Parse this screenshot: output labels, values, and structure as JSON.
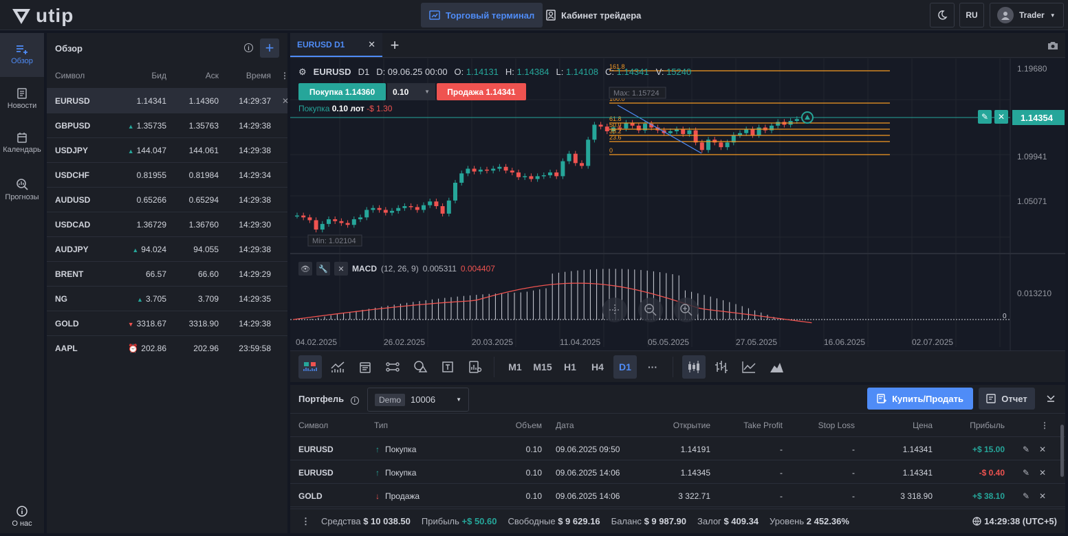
{
  "app": {
    "logo_text": "utip",
    "nav_terminal": "Торговый терминал",
    "nav_cabinet": "Кабинет трейдера",
    "lang": "RU",
    "user": "Trader"
  },
  "sidebar": {
    "items": [
      {
        "label": "Обзор",
        "icon": "overview-icon"
      },
      {
        "label": "Новости",
        "icon": "news-icon"
      },
      {
        "label": "Календарь",
        "icon": "calendar-icon"
      },
      {
        "label": "Прогнозы",
        "icon": "forecast-icon"
      }
    ],
    "about": "О нас"
  },
  "watchlist": {
    "title": "Обзор",
    "columns": {
      "symbol": "Символ",
      "bid": "Бид",
      "ask": "Аск",
      "time": "Время"
    },
    "rows": [
      {
        "symbol": "EURUSD",
        "dir": "",
        "bid": "1.14341",
        "ask": "1.14360",
        "time": "14:29:37"
      },
      {
        "symbol": "GBPUSD",
        "dir": "up",
        "bid": "1.35735",
        "ask": "1.35763",
        "time": "14:29:38"
      },
      {
        "symbol": "USDJPY",
        "dir": "up",
        "bid": "144.047",
        "ask": "144.061",
        "time": "14:29:38"
      },
      {
        "symbol": "USDCHF",
        "dir": "",
        "bid": "0.81955",
        "ask": "0.81984",
        "time": "14:29:34"
      },
      {
        "symbol": "AUDUSD",
        "dir": "",
        "bid": "0.65266",
        "ask": "0.65294",
        "time": "14:29:38"
      },
      {
        "symbol": "USDCAD",
        "dir": "",
        "bid": "1.36729",
        "ask": "1.36760",
        "time": "14:29:30"
      },
      {
        "symbol": "AUDJPY",
        "dir": "up",
        "bid": "94.024",
        "ask": "94.055",
        "time": "14:29:38"
      },
      {
        "symbol": "BRENT",
        "dir": "",
        "bid": "66.57",
        "ask": "66.60",
        "time": "14:29:29"
      },
      {
        "symbol": "NG",
        "dir": "up",
        "bid": "3.705",
        "ask": "3.709",
        "time": "14:29:35"
      },
      {
        "symbol": "GOLD",
        "dir": "down",
        "bid": "3318.67",
        "ask": "3318.90",
        "time": "14:29:38"
      },
      {
        "symbol": "AAPL",
        "dir": "clock",
        "bid": "202.86",
        "ask": "202.96",
        "time": "23:59:58"
      }
    ]
  },
  "chart": {
    "tab_label": "EURUSD D1",
    "symbol": "EURUSD",
    "timeframe": "D1",
    "date": "D: 09.06.25 00:00",
    "open_label": "O:",
    "open": "1.14131",
    "high_label": "H:",
    "high": "1.14384",
    "low_label": "L:",
    "low": "1.14108",
    "close_label": "C:",
    "close": "1.14341",
    "vol_label": "V:",
    "vol": "15240",
    "buy_button": "Покупка 1.14360",
    "sell_button": "Продажа 1.14341",
    "lot": "0.10",
    "position_prefix": "Покупка",
    "position_lot": "0.10 лот",
    "position_pl": "-$ 1.30",
    "current_price": "1.14354",
    "max_label": "Max: 1.15724",
    "min_label": "Min: 1.02104",
    "price_axis": [
      "1.19680",
      "1.09941",
      "1.05071"
    ],
    "fib_levels": [
      "161.8",
      "100.0",
      "61.8",
      "50.0",
      "38.2",
      "23.6",
      "0"
    ],
    "macd_label": "MACD",
    "macd_params": "(12, 26, 9)",
    "macd_val1": "0.005311",
    "macd_val2": "0.004407",
    "macd_axis": [
      "0.013210",
      "0"
    ],
    "date_axis": [
      "04.02.2025",
      "26.02.2025",
      "20.03.2025",
      "11.04.2025",
      "05.05.2025",
      "27.05.2025",
      "16.06.2025",
      "02.07.2025"
    ],
    "timeframes": [
      "M1",
      "M15",
      "H1",
      "H4",
      "D1"
    ],
    "more": "···",
    "colors": {
      "up": "#26a69a",
      "down": "#ef5350",
      "fib": "#f59a23",
      "accent": "#4f8cf7"
    }
  },
  "portfolio": {
    "title": "Портфель",
    "account_type": "Demo",
    "account_id": "10006",
    "buy_sell_button": "Купить/Продать",
    "report_button": "Отчет",
    "columns": {
      "symbol": "Символ",
      "type": "Тип",
      "volume": "Объем",
      "date": "Дата",
      "open": "Открытие",
      "tp": "Take Profit",
      "sl": "Stop Loss",
      "price": "Цена",
      "profit": "Прибыль"
    },
    "rows": [
      {
        "symbol": "EURUSD",
        "dir": "up",
        "type": "Покупка",
        "volume": "0.10",
        "date": "09.06.2025 09:50",
        "open": "1.14191",
        "tp": "-",
        "sl": "-",
        "price": "1.14341",
        "profit": "+$ 15.00",
        "pos": true
      },
      {
        "symbol": "EURUSD",
        "dir": "up",
        "type": "Покупка",
        "volume": "0.10",
        "date": "09.06.2025 14:06",
        "open": "1.14345",
        "tp": "-",
        "sl": "-",
        "price": "1.14341",
        "profit": "-$ 0.40",
        "pos": false
      },
      {
        "symbol": "GOLD",
        "dir": "down",
        "type": "Продажа",
        "volume": "0.10",
        "date": "09.06.2025 14:06",
        "open": "3 322.71",
        "tp": "-",
        "sl": "-",
        "price": "3 318.90",
        "profit": "+$ 38.10",
        "pos": true
      }
    ],
    "footer": {
      "funds_label": "Средства",
      "funds": "$ 10 038.50",
      "profit_label": "Прибыль",
      "profit": "+$ 50.60",
      "free_label": "Свободные",
      "free": "$ 9 629.16",
      "balance_label": "Баланс",
      "balance": "$ 9 987.90",
      "margin_label": "Залог",
      "margin": "$ 409.34",
      "level_label": "Уровень",
      "level": "2 452.36%",
      "clock": "14:29:38 (UTC+5)"
    }
  }
}
